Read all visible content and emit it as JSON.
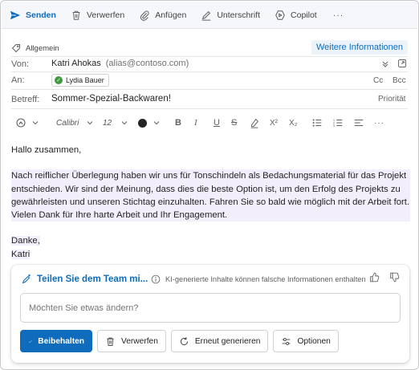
{
  "toolbar": {
    "send_label": "Senden",
    "discard_label": "Verwerfen",
    "attach_label": "Anfügen",
    "signature_label": "Unterschrift",
    "copilot_label": "Copilot",
    "more_label": "···"
  },
  "header": {
    "sensitivity_tag": "Allgemein",
    "more_info_label": "Weitere Informationen",
    "from_label": "Von:",
    "from_name": "Katri Ahokas",
    "from_alias": "(alias@contoso.com)",
    "to_label": "An:",
    "to_recipient": "Lydia Bauer",
    "cc_label": "Cc",
    "bcc_label": "Bcc",
    "subject_label": "Betreff:",
    "subject_value": "Sommer-Spezial-Backwaren!",
    "priority_label": "Priorität"
  },
  "format_bar": {
    "font_name": "Calibri",
    "font_size": "12",
    "bold": "B",
    "italic": "I",
    "underline": "U",
    "strikethrough": "S",
    "superscript": "X²",
    "subscript": "X₂"
  },
  "body": {
    "greeting": "Hallo zusammen,",
    "paragraph": "Nach reiflicher Überlegung haben wir uns für Tonschindeln als Bedachungsmaterial für das Projekt entschieden. Wir sind der Meinung, dass dies die beste Option ist, um den Erfolg des Projekts zu gewährleisten und unseren Stichtag einzuhalten. Fahren Sie so bald wie möglich mit der Arbeit fort. Vielen Dank für Ihre harte Arbeit und Ihr Engagement.",
    "closing": "Danke,",
    "signature": "Katri"
  },
  "copilot": {
    "title": "Teilen Sie dem Team mi...",
    "disclaimer": "KI-generierte Inhalte können falsche Informationen enthalten",
    "input_placeholder": "Möchten Sie etwas ändern?",
    "keep_label": "Beibehalten",
    "discard_label": "Verwerfen",
    "regenerate_label": "Erneut generieren",
    "options_label": "Optionen"
  },
  "colors": {
    "accent": "#0f6cbd",
    "highlight": "#f3eefb",
    "avatar": "#3f9a3f"
  }
}
